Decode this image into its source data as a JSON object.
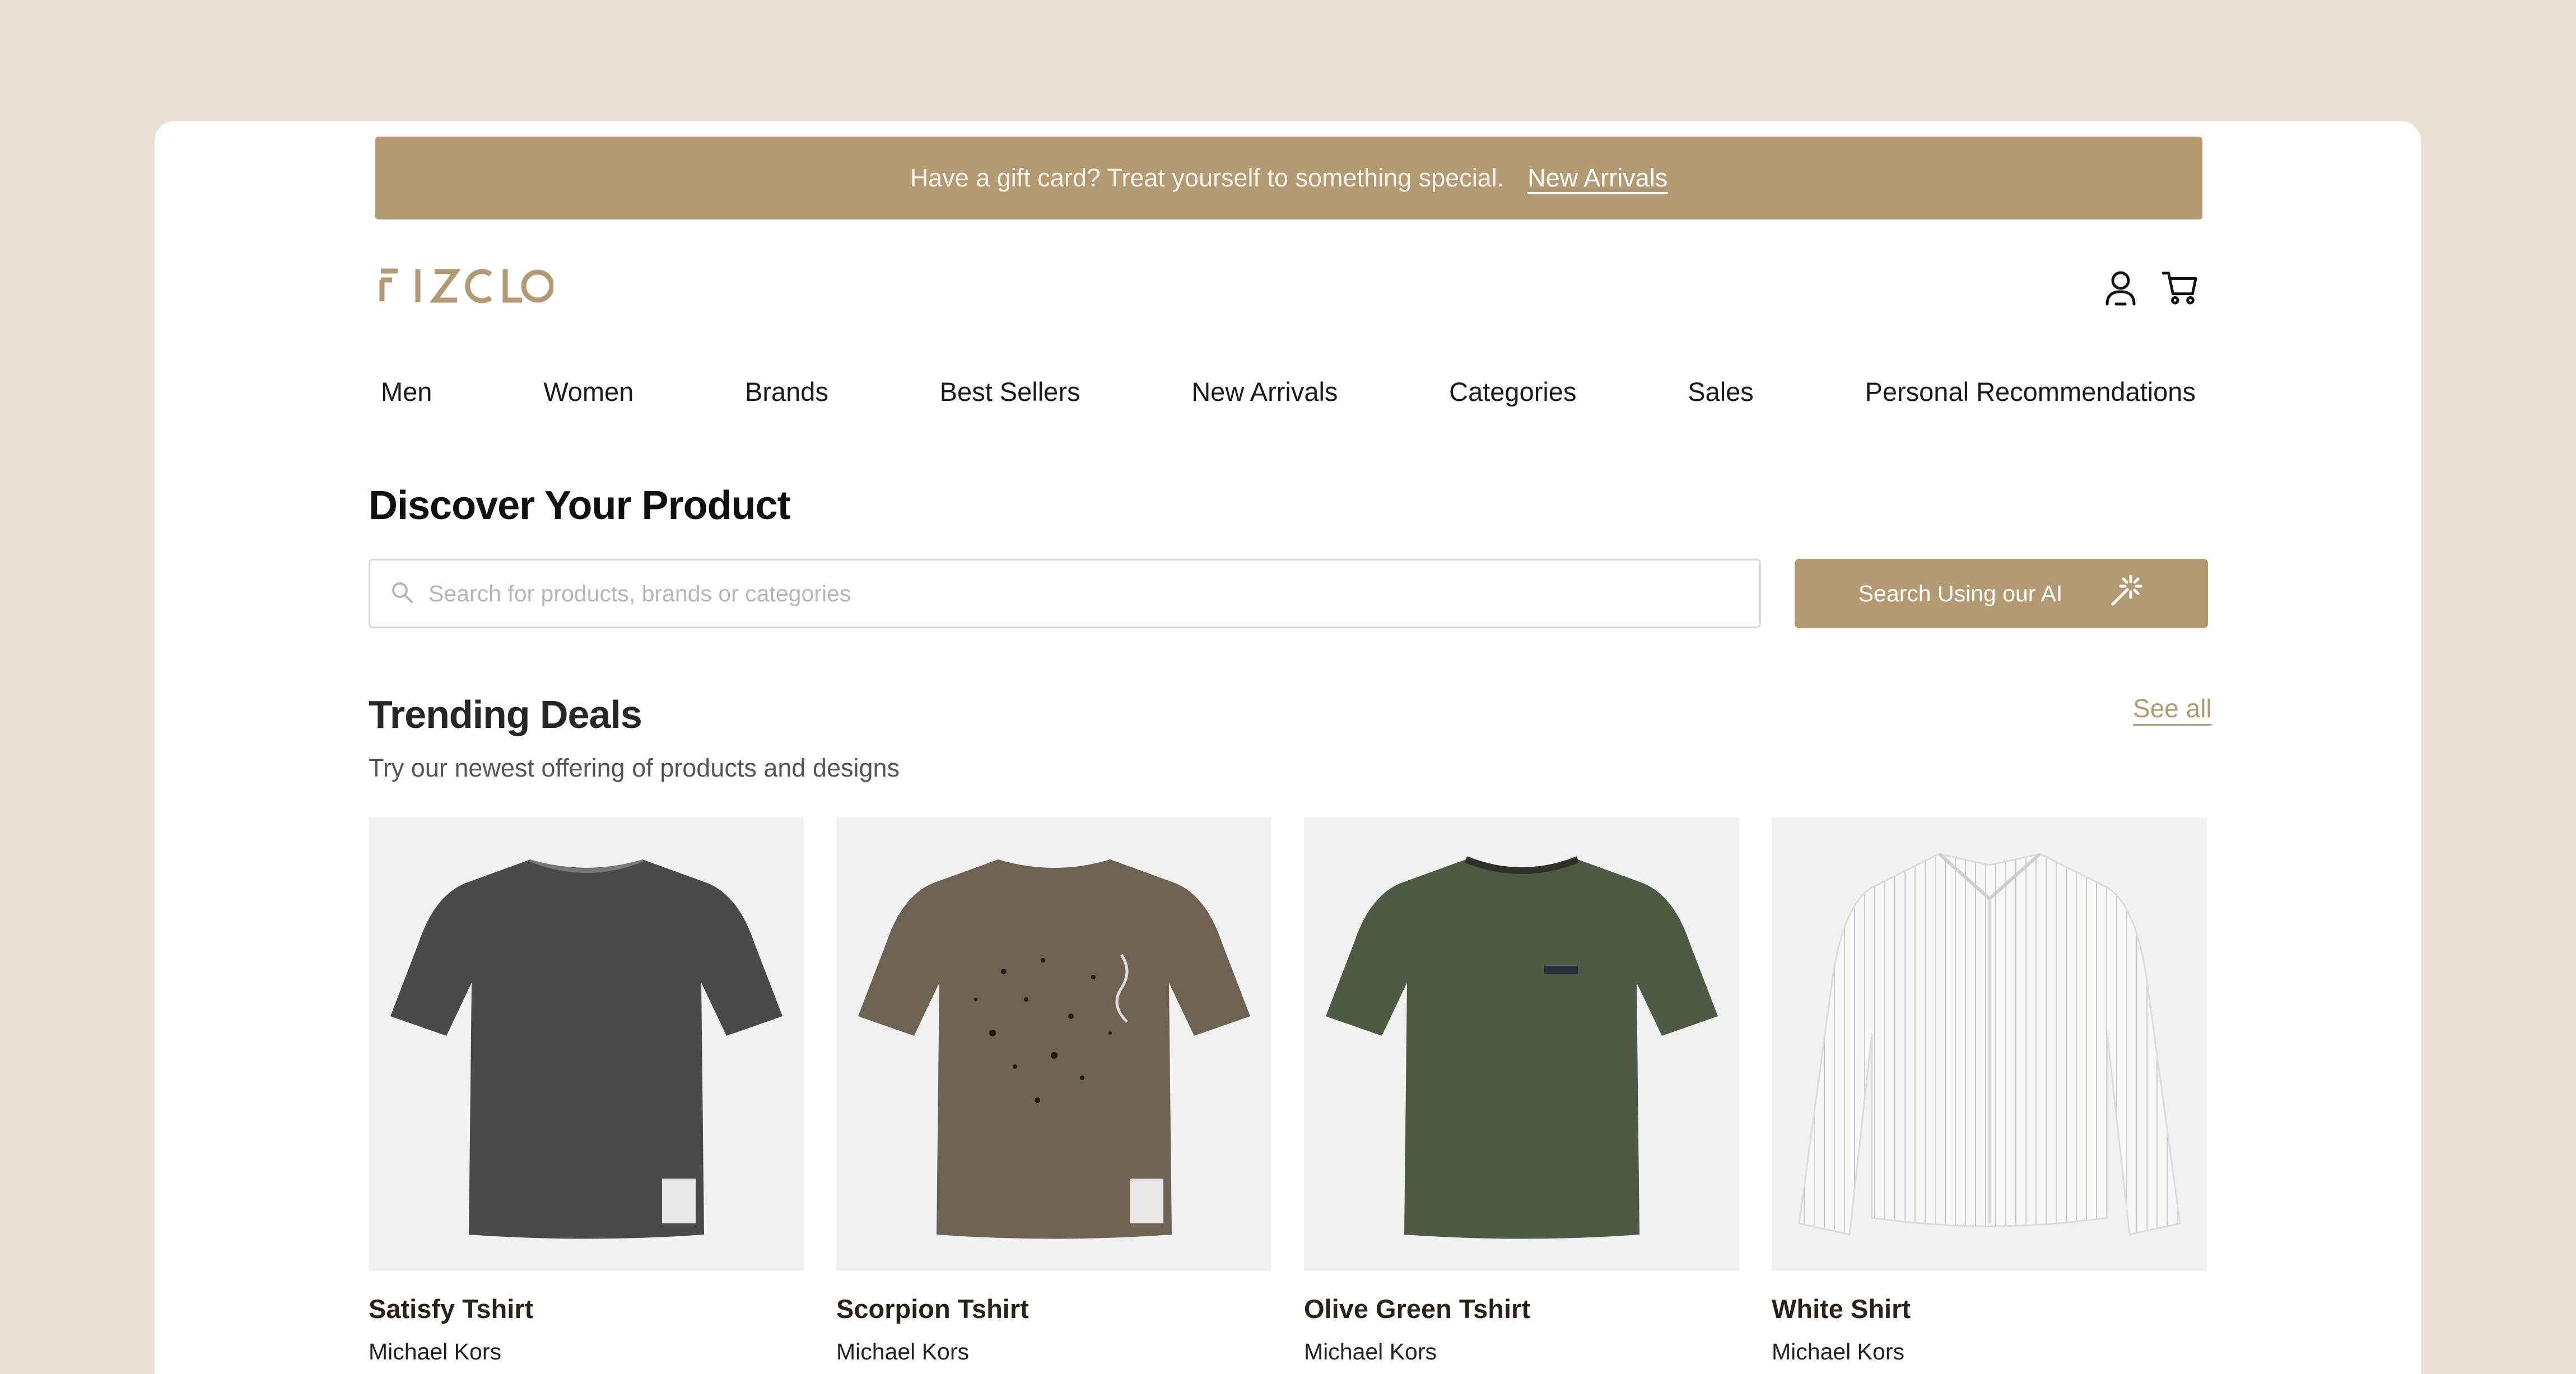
{
  "promo": {
    "text": "Have a gift card? Treat yourself to something special.",
    "link_label": "New Arrivals"
  },
  "brand": {
    "logo_text": "FIZCLO",
    "accent": "#B39A73"
  },
  "header": {
    "icons": [
      "user-icon",
      "cart-icon"
    ]
  },
  "nav": {
    "items": [
      "Men",
      "Women",
      "Brands",
      "Best Sellers",
      "New Arrivals",
      "Categories",
      "Sales",
      "Personal Recommendations"
    ]
  },
  "discover": {
    "title": "Discover Your Product",
    "search_placeholder": "Search for products, brands or categories",
    "search_value": "",
    "ai_button_label": "Search Using our AI"
  },
  "trending": {
    "title": "Trending Deals",
    "subtitle": "Try our newest offering of products and designs",
    "see_all_label": "See all",
    "products": [
      {
        "name": "Satisfy Tshirt",
        "brand": "Michael Kors",
        "color": "#4a4a4a"
      },
      {
        "name": "Scorpion Tshirt",
        "brand": "Michael Kors",
        "color": "#6e6253"
      },
      {
        "name": "Olive Green Tshirt",
        "brand": "Michael Kors",
        "color": "#4f5a45"
      },
      {
        "name": "White Shirt",
        "brand": "Michael Kors",
        "color": "#f4f4f4"
      }
    ]
  }
}
